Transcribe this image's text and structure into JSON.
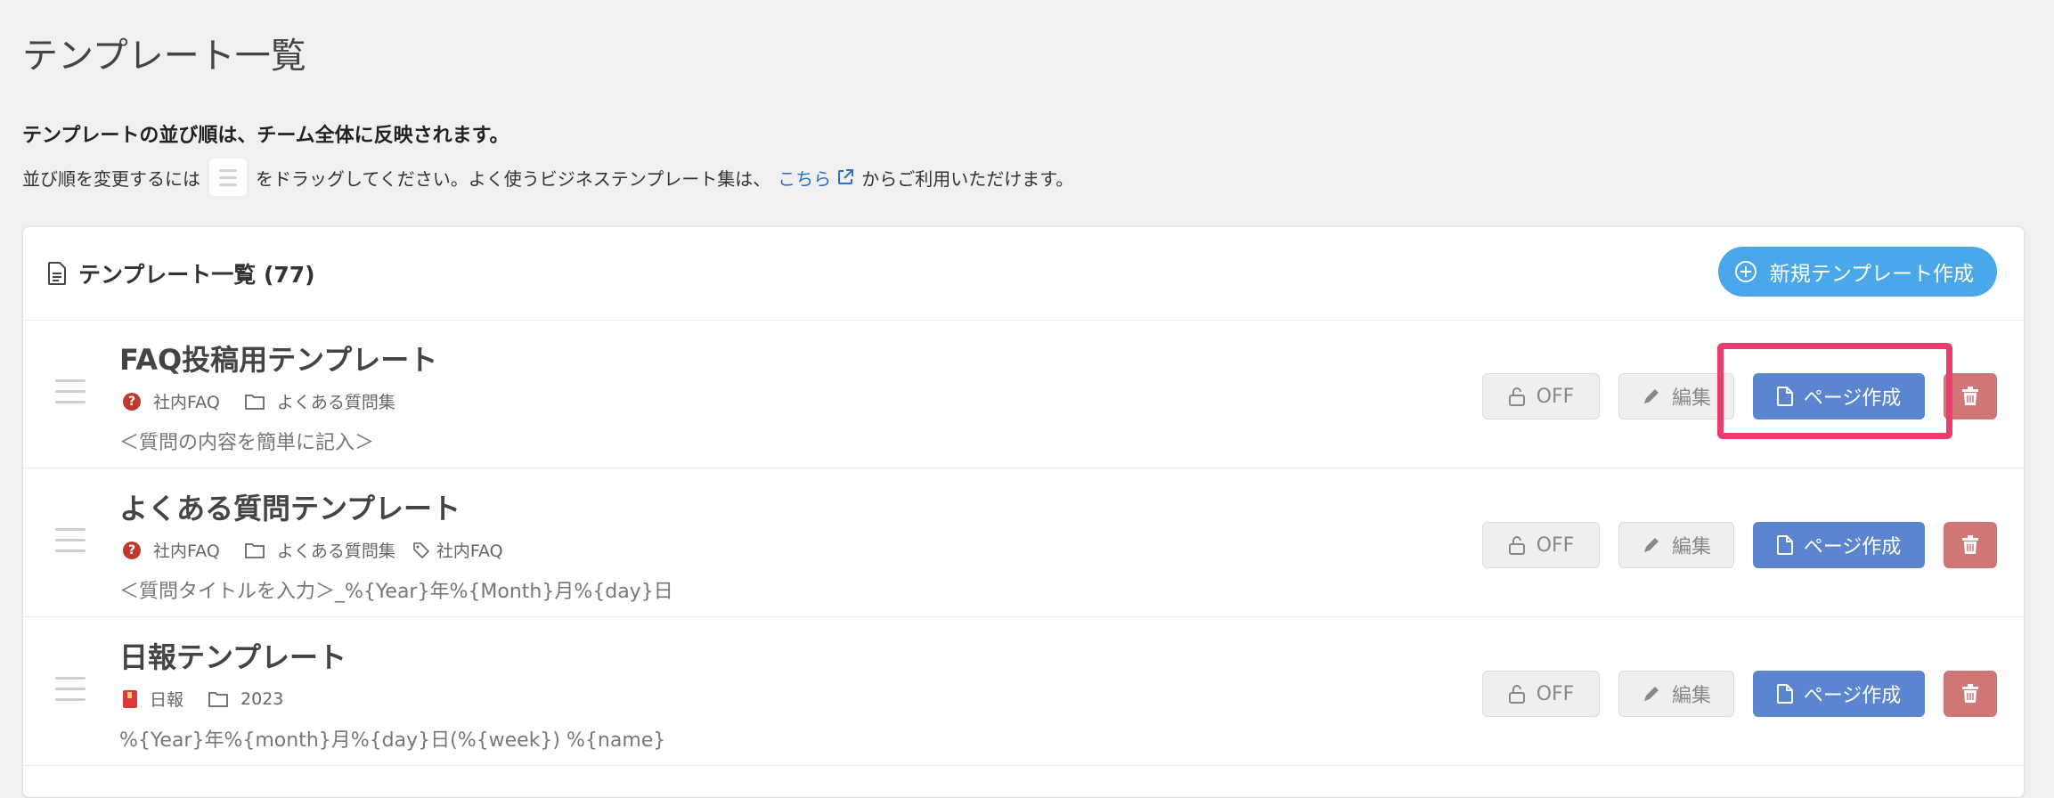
{
  "page": {
    "title": "テンプレート一覧"
  },
  "notice": {
    "bold": "テンプレートの並び順は、チーム全体に反映されます。",
    "line_before": "並び順を変更するには",
    "line_after": "をドラッグしてください。よく使うビジネステンプレート集は、",
    "link_text": "こちら",
    "line_end": "からご利用いただけます。"
  },
  "card": {
    "title": "テンプレート一覧 (77)",
    "new_button": "新規テンプレート作成"
  },
  "buttons": {
    "off": "OFF",
    "edit": "編集",
    "page": "ページ作成"
  },
  "templates": [
    {
      "title": "FAQ投稿用テンプレート",
      "category": "社内FAQ",
      "folder": "よくある質問集",
      "tag": "",
      "description": "＜質問の内容を簡単に記入＞"
    },
    {
      "title": "よくある質問テンプレート",
      "category": "社内FAQ",
      "folder": "よくある質問集",
      "tag": "社内FAQ",
      "description": "＜質問タイトルを入力＞_%{Year}年%{Month}月%{day}日"
    },
    {
      "title": "日報テンプレート",
      "category": "日報",
      "folder": "2023",
      "tag": "",
      "description": "%{Year}年%{month}月%{day}日(%{week}) %{name}"
    }
  ],
  "colors": {
    "new_button": "#4aa8ea",
    "page_button": "#5b85cf",
    "delete_button": "#cf7676",
    "highlight": "#ea3c6e",
    "link": "#2a72c5"
  }
}
